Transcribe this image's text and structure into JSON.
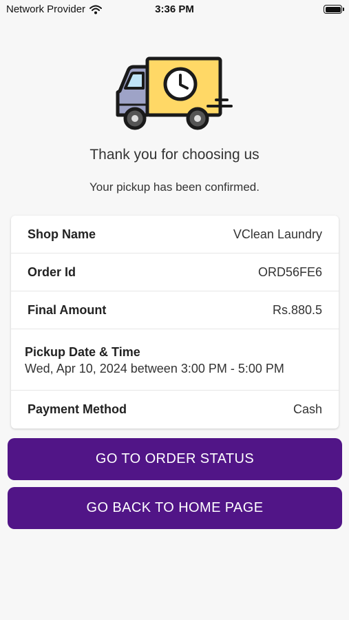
{
  "status_bar": {
    "carrier": "Network Provider",
    "time": "3:36 PM",
    "wifi_icon": "wifi-icon",
    "battery_icon": "battery-icon"
  },
  "hero": {
    "icon": "delivery-truck-clock-icon",
    "colors": {
      "body": "#FFD866",
      "cab": "#9EA3C7",
      "outline": "#1a1a1a",
      "window": "#BFE3F7"
    }
  },
  "message": {
    "title": "Thank you for choosing us",
    "subtitle": "Your pickup has been confirmed."
  },
  "details": {
    "shop_name_label": "Shop Name",
    "shop_name_value": "VClean Laundry",
    "order_id_label": "Order Id",
    "order_id_value": "ORD56FE6",
    "final_amount_label": "Final Amount",
    "final_amount_value": "Rs.880.5",
    "pickup_label": "Pickup Date & Time",
    "pickup_value": "Wed, Apr 10, 2024 between 3:00 PM - 5:00 PM",
    "payment_label": "Payment Method",
    "payment_value": "Cash"
  },
  "buttons": {
    "order_status": "GO TO ORDER STATUS",
    "home": "GO BACK TO HOME PAGE"
  },
  "colors": {
    "primary": "#511587",
    "background": "#F7F7F7"
  }
}
